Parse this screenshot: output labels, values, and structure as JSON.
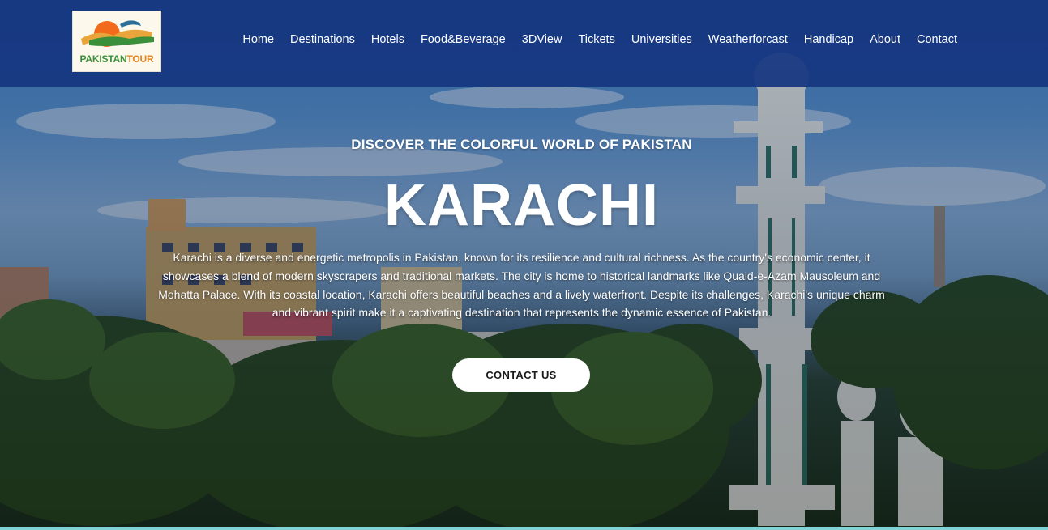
{
  "brand": {
    "logo_text_part1": "PAKISTAN",
    "logo_text_part2": "TOUR"
  },
  "nav": {
    "items": [
      {
        "label": "Home"
      },
      {
        "label": "Destinations"
      },
      {
        "label": "Hotels"
      },
      {
        "label": "Food&Beverage"
      },
      {
        "label": "3DView"
      },
      {
        "label": "Tickets"
      },
      {
        "label": "Universities"
      },
      {
        "label": "Weatherforcast"
      },
      {
        "label": "Handicap"
      },
      {
        "label": "About"
      },
      {
        "label": "Contact"
      }
    ]
  },
  "hero": {
    "kicker": "DISCOVER THE COLORFUL WORLD OF PAKISTAN",
    "title": "KARACHI",
    "description": "Karachi is a diverse and energetic metropolis in Pakistan, known for its resilience and cultural richness. As the country's economic center, it showcases a blend of modern skyscrapers and traditional markets. The city is home to historical landmarks like Quaid-e-Azam Mausoleum and Mohatta Palace. With its coastal location, Karachi offers beautiful beaches and a lively waterfront. Despite its challenges, Karachi's unique charm and vibrant spirit make it a captivating destination that represents the dynamic essence of Pakistan.",
    "cta_label": "CONTACT US"
  },
  "colors": {
    "header_bg": "#153680",
    "accent_line": "#7fd3d8",
    "button_bg": "#ffffff"
  }
}
